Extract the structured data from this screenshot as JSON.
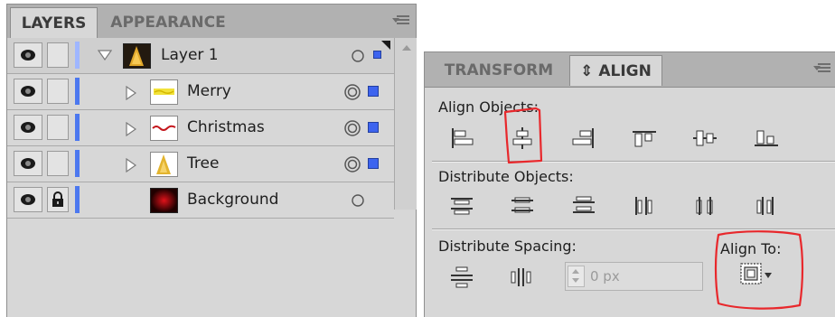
{
  "layers_panel": {
    "tabs": [
      {
        "label": "LAYERS",
        "active": true
      },
      {
        "label": "APPEARANCE",
        "active": false
      }
    ],
    "menu_icon": "panel-menu-icon",
    "layers": [
      {
        "name": "Layer 1",
        "level": 0,
        "expanded": true,
        "visible": true,
        "locked": false,
        "thumbnail": "tree-thumbnail",
        "target": "single-circle",
        "selected": true
      },
      {
        "name": "Merry",
        "level": 1,
        "expanded": false,
        "visible": true,
        "locked": false,
        "thumbnail": "merry-thumbnail",
        "target": "double-circle",
        "selected": true
      },
      {
        "name": "Christmas",
        "level": 1,
        "expanded": false,
        "visible": true,
        "locked": false,
        "thumbnail": "christmas-thumbnail",
        "target": "double-circle",
        "selected": true
      },
      {
        "name": "Tree",
        "level": 1,
        "expanded": false,
        "visible": true,
        "locked": false,
        "thumbnail": "tree-thumbnail",
        "target": "double-circle",
        "selected": true
      },
      {
        "name": "Background",
        "level": 1,
        "expanded": false,
        "visible": true,
        "locked": true,
        "thumbnail": "background-thumbnail",
        "target": "single-circle",
        "selected": false
      }
    ]
  },
  "align_panel": {
    "tabs": [
      {
        "label": "TRANSFORM",
        "active": false
      },
      {
        "label": "ALIGN",
        "prefix": "⇕",
        "active": true
      }
    ],
    "menu_icon": "panel-menu-icon",
    "align_objects_label": "Align Objects:",
    "align_objects_buttons": [
      "horizontal-align-left",
      "horizontal-align-center",
      "horizontal-align-right",
      "vertical-align-top",
      "vertical-align-center",
      "vertical-align-bottom"
    ],
    "distribute_objects_label": "Distribute Objects:",
    "distribute_objects_buttons": [
      "vertical-distribute-top",
      "vertical-distribute-center",
      "vertical-distribute-bottom",
      "horizontal-distribute-left",
      "horizontal-distribute-center",
      "horizontal-distribute-right"
    ],
    "distribute_spacing_label": "Distribute Spacing:",
    "distribute_spacing_buttons": [
      "vertical-distribute-space",
      "horizontal-distribute-space"
    ],
    "spacing_value": "0 px",
    "align_to_label": "Align To:",
    "align_to_icon": "align-to-selection-icon",
    "annotation_color": "#e8282c"
  },
  "colors": {
    "panel_bg": "#d7d7d7",
    "tab_bar": "#b1b1b1",
    "layer_color": "#4c78ef"
  }
}
